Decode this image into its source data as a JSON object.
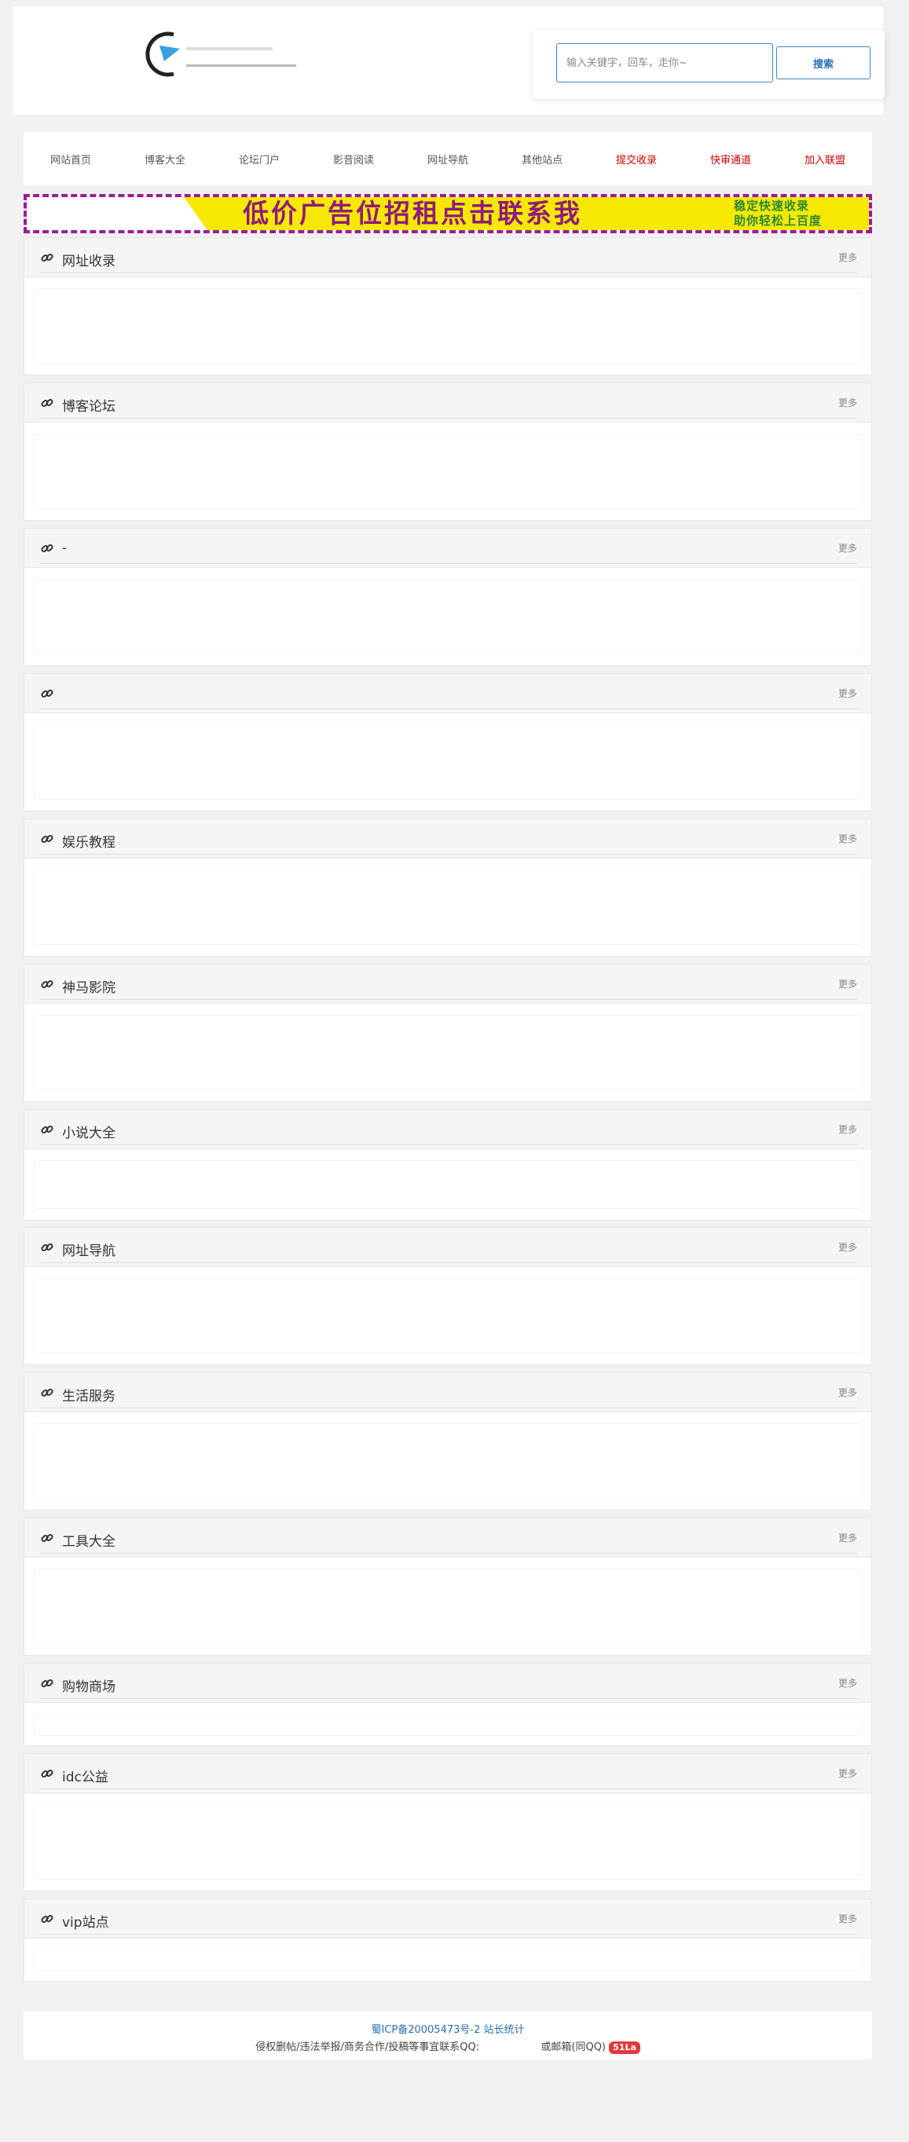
{
  "search": {
    "placeholder": "输入关键字，回车，走你~",
    "button_label": "搜索"
  },
  "nav": {
    "items": [
      {
        "label": "网站首页"
      },
      {
        "label": "博客大全"
      },
      {
        "label": "论坛门户"
      },
      {
        "label": "影音阅读"
      },
      {
        "label": "网址导航"
      },
      {
        "label": "其他站点"
      },
      {
        "label": "提交收录"
      },
      {
        "label": "快审通道"
      },
      {
        "label": "加入联盟"
      }
    ]
  },
  "ad": {
    "main_text": "低价广告位招租点击联系我",
    "side_line1": "稳定快速收录",
    "side_line2": "助你轻松上百度"
  },
  "sections": [
    {
      "title": "网址收录",
      "more": "更多"
    },
    {
      "title": "博客论坛",
      "more": "更多"
    },
    {
      "title": "-",
      "more": "更多"
    },
    {
      "title": "",
      "more": "更多"
    },
    {
      "title": "娱乐教程",
      "more": "更多"
    },
    {
      "title": "神马影院",
      "more": "更多"
    },
    {
      "title": "小说大全",
      "more": "更多"
    },
    {
      "title": "网址导航",
      "more": "更多"
    },
    {
      "title": "生活服务",
      "more": "更多"
    },
    {
      "title": "工具大全",
      "more": "更多"
    },
    {
      "title": "购物商场",
      "more": "更多"
    },
    {
      "title": "idc公益",
      "more": "更多"
    },
    {
      "title": "vip站点",
      "more": "更多"
    }
  ],
  "footer": {
    "icp": "蜀ICP备20005473号-2",
    "stats": "站长统计",
    "contact": "侵权删帖/违法举报/商务合作/投稿等事宜联系QQ:",
    "email": "或邮箱(同QQ)",
    "badge": "51La"
  },
  "colors": {
    "accent": "#3a86c8",
    "highlight_nav": "#cc0000",
    "ad_border": "#9b1c9b",
    "ad_yellow": "#f6e800",
    "ad_text": "#8e1a7d"
  }
}
